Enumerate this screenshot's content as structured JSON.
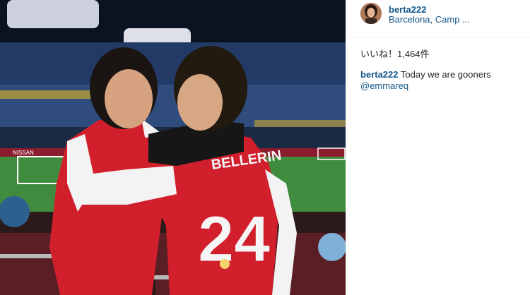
{
  "post": {
    "username": "berta222",
    "location": "Barcelona, Camp ...",
    "likes": "いいね！1,464件",
    "caption_user": "berta222",
    "caption_text": "Today we are gooners",
    "caption_mention": "@emmareq"
  },
  "photo": {
    "jersey_name": "BELLERIN",
    "jersey_number": "24",
    "banner_text": "NISSAN"
  }
}
